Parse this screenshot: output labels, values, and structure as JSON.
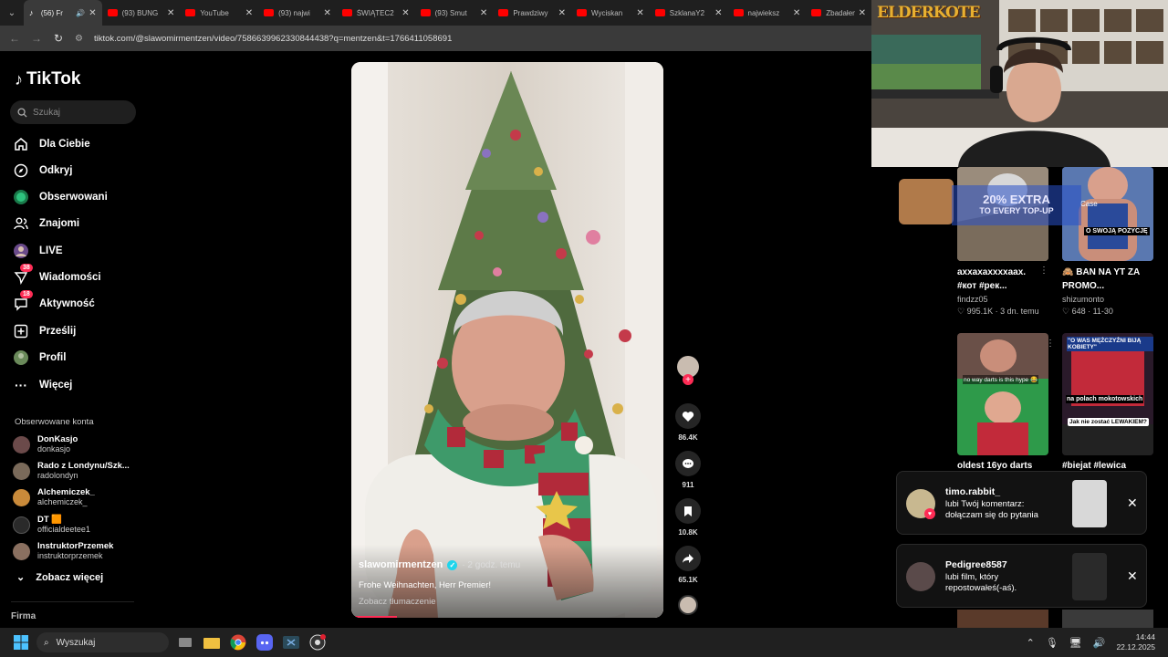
{
  "browser": {
    "tabs": [
      {
        "label": "(56) Fr",
        "type": "tiktok",
        "active": true
      },
      {
        "label": "(93) BUNG",
        "type": "youtube"
      },
      {
        "label": "YouTube",
        "type": "youtube"
      },
      {
        "label": "(93) najwi",
        "type": "youtube"
      },
      {
        "label": "ŚWIĄTEC2",
        "type": "youtube"
      },
      {
        "label": "(93) Smut",
        "type": "youtube"
      },
      {
        "label": "Prawdziwy",
        "type": "youtube"
      },
      {
        "label": "Wyciskan",
        "type": "youtube"
      },
      {
        "label": "SzklanaY2",
        "type": "youtube"
      },
      {
        "label": "najwieksz",
        "type": "youtube"
      },
      {
        "label": "Zbadałem",
        "type": "youtube"
      }
    ],
    "url": "tiktok.com/@slawomirmentzen/video/7586639962330844438?q=mentzen&t=1766411058691"
  },
  "sidebar": {
    "logo": "TikTok",
    "search_placeholder": "Szukaj",
    "nav": [
      {
        "label": "Dla Ciebie",
        "icon": "home-icon"
      },
      {
        "label": "Odkryj",
        "icon": "compass-icon"
      },
      {
        "label": "Obserwowani",
        "icon": "following-icon"
      },
      {
        "label": "Znajomi",
        "icon": "friends-icon"
      },
      {
        "label": "LIVE",
        "icon": "live-icon"
      },
      {
        "label": "Wiadomości",
        "icon": "messages-icon",
        "badge": "38"
      },
      {
        "label": "Aktywność",
        "icon": "activity-icon",
        "badge": "18"
      },
      {
        "label": "Prześlij",
        "icon": "upload-icon"
      },
      {
        "label": "Profil",
        "icon": "profile-icon"
      },
      {
        "label": "Więcej",
        "icon": "more-icon"
      }
    ],
    "followed_title": "Obserwowane konta",
    "followed": [
      {
        "name": "DonKasjo",
        "handle": "donkasjo",
        "color": "#6b4a4a"
      },
      {
        "name": "Rado z Londynu/Szk...",
        "handle": "radolondyn",
        "color": "#7a6a5a"
      },
      {
        "name": "Alchemiczek_",
        "handle": "alchemiczek_",
        "color": "#c98a3a"
      },
      {
        "name": "DT 🟧",
        "handle": "officialdeetee1",
        "color": "#2a2a2a"
      },
      {
        "name": "InstruktorPrzemek",
        "handle": "instruktorprzemek",
        "color": "#8a7060"
      }
    ],
    "see_more": "Zobacz więcej",
    "footer": "Firma"
  },
  "video": {
    "author": "slawomirmentzen",
    "time": "· 2 godz. temu",
    "caption": "Frohe Weihnachten, Herr Premier!",
    "translate": "Zobacz tłumaczenie",
    "likes": "86.4K",
    "comments": "911",
    "saves": "10.8K",
    "shares": "65.1K"
  },
  "related": [
    {
      "title1": "axxaxaxxxxaax.",
      "title2": "#кот #рек...",
      "author": "findzz05",
      "meta": "♡ 995.1K · 3 dn. temu"
    },
    {
      "title1": "🙈 BAN NA YT ZA",
      "title2": "PROMO...",
      "author": "shizumonto",
      "meta": "♡ 648 · 11-30"
    },
    {
      "title1": "oldest 16yo darts",
      "title2": "",
      "author": "",
      "meta": ""
    },
    {
      "title1": "#biejat #lewica",
      "title2": "",
      "author": "",
      "meta": ""
    }
  ],
  "thumb_texts": {
    "promo": "20% EXTRA",
    "promo2": "TO EVERY TOP-UP",
    "swoja": "O SWOJĄ POZYCJĘ",
    "darts": "no way darts is this hype 😂",
    "mezczyzni": "\"O WAS MĘŻCZYŹNI BIJĄ KOBIETY\"",
    "mokotow": "na polach mokotowskich",
    "lewak": "Jak nie zostać LEWAKIEM?",
    "case": "Case"
  },
  "notifications": [
    {
      "user": "timo.rabbit_",
      "text": "lubi Twój komentarz: dołączam się do pytania"
    },
    {
      "user": "Pedigree8587",
      "text": "lubi film, który repostowałeś(-aś)."
    }
  ],
  "webcam": {
    "overlay": "ELDERKOTE"
  },
  "taskbar": {
    "search": "Wyszukaj",
    "time": "14:44",
    "date": "22.12.2025"
  }
}
